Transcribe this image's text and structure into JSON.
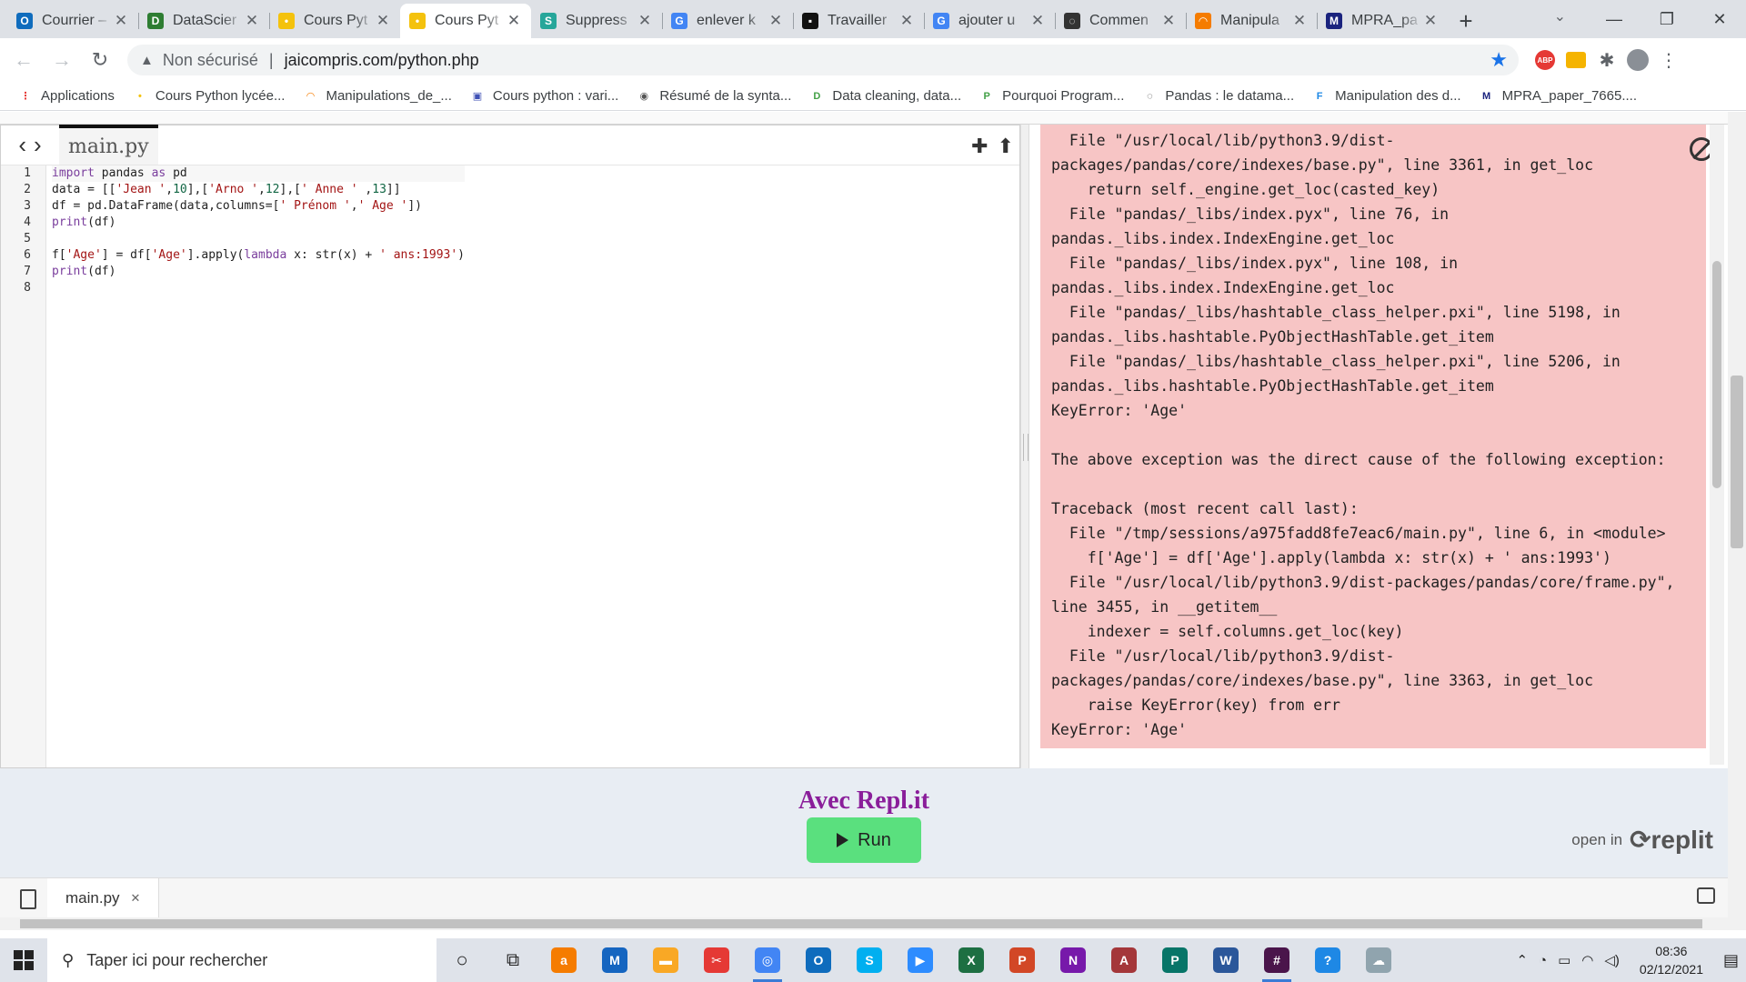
{
  "browser": {
    "tabs": [
      {
        "title": "Courrier –",
        "color": "#0f6cbd",
        "glyph": "O"
      },
      {
        "title": "DataScier",
        "color": "#2e7d32",
        "glyph": "D"
      },
      {
        "title": "Cours Pyt",
        "color": "#f4c20d",
        "glyph": "•"
      },
      {
        "title": "Cours Pyt",
        "color": "#f4c20d",
        "glyph": "•",
        "active": true
      },
      {
        "title": "Suppress",
        "color": "#26a69a",
        "glyph": "S"
      },
      {
        "title": "enlever k",
        "color": "#4285f4",
        "glyph": "G"
      },
      {
        "title": "Travailler",
        "color": "#111111",
        "glyph": "▪"
      },
      {
        "title": "ajouter u",
        "color": "#4285f4",
        "glyph": "G"
      },
      {
        "title": "Commen",
        "color": "#333333",
        "glyph": "◌"
      },
      {
        "title": "Manipula",
        "color": "#f57c00",
        "glyph": "◠"
      },
      {
        "title": "MPRA_pa",
        "color": "#1a237e",
        "glyph": "M"
      }
    ],
    "address": {
      "security": "Non sécurisé",
      "url": "jaicompris.com/python.php"
    },
    "bookmarks": [
      {
        "label": "Applications",
        "color": "#e53935",
        "glyph": "⋮"
      },
      {
        "label": "Cours Python lycée...",
        "color": "#f4c20d",
        "glyph": "•"
      },
      {
        "label": "Manipulations_de_...",
        "color": "#f57c00",
        "glyph": "◠"
      },
      {
        "label": "Cours python : vari...",
        "color": "#3f51b5",
        "glyph": "▣"
      },
      {
        "label": "Résumé de la synta...",
        "color": "#555555",
        "glyph": "◉"
      },
      {
        "label": "Data cleaning, data...",
        "color": "#43a047",
        "glyph": "D"
      },
      {
        "label": "Pourquoi Program...",
        "color": "#43a047",
        "glyph": "P"
      },
      {
        "label": "Pandas : le datama...",
        "color": "#333333",
        "glyph": "◌"
      },
      {
        "label": "Manipulation des d...",
        "color": "#1e88e5",
        "glyph": "F"
      },
      {
        "label": "MPRA_paper_7665....",
        "color": "#1a237e",
        "glyph": "M"
      }
    ]
  },
  "editor": {
    "file_tab": "main.py",
    "lines": [
      "1",
      "2",
      "3",
      "4",
      "5",
      "6",
      "7",
      "8"
    ]
  },
  "console": {
    "error_text": "  File \"/usr/local/lib/python3.9/dist-\npackages/pandas/core/indexes/base.py\", line 3361, in get_loc\n    return self._engine.get_loc(casted_key)\n  File \"pandas/_libs/index.pyx\", line 76, in\npandas._libs.index.IndexEngine.get_loc\n  File \"pandas/_libs/index.pyx\", line 108, in\npandas._libs.index.IndexEngine.get_loc\n  File \"pandas/_libs/hashtable_class_helper.pxi\", line 5198, in\npandas._libs.hashtable.PyObjectHashTable.get_item\n  File \"pandas/_libs/hashtable_class_helper.pxi\", line 5206, in\npandas._libs.hashtable.PyObjectHashTable.get_item\nKeyError: 'Age'\n\nThe above exception was the direct cause of the following exception:\n\nTraceback (most recent call last):\n  File \"/tmp/sessions/a975fadd8fe7eac6/main.py\", line 6, in <module>\n    f['Age'] = df['Age'].apply(lambda x: str(x) + ' ans:1993')\n  File \"/usr/local/lib/python3.9/dist-packages/pandas/core/frame.py\",\nline 3455, in __getitem__\n    indexer = self.columns.get_loc(key)\n  File \"/usr/local/lib/python3.9/dist-\npackages/pandas/core/indexes/base.py\", line 3363, in get_loc\n    raise KeyError(key) from err\nKeyError: 'Age'"
  },
  "runner": {
    "title": "Avec Repl.it",
    "run_label": "Run",
    "open_in": "open in",
    "brand": "replit"
  },
  "bottom_file_tab": "main.py",
  "taskbar": {
    "search_placeholder": "Taper ici pour rechercher",
    "time": "08:36",
    "date": "02/12/2021",
    "apps": [
      {
        "name": "avast",
        "color": "#f57c00",
        "glyph": "a"
      },
      {
        "name": "malwarebytes",
        "color": "#1565c0",
        "glyph": "M"
      },
      {
        "name": "explorer",
        "color": "#f9a825",
        "glyph": "▬"
      },
      {
        "name": "snip",
        "color": "#e53935",
        "glyph": "✂"
      },
      {
        "name": "chrome",
        "color": "#4285f4",
        "glyph": "◎",
        "running": true
      },
      {
        "name": "outlook",
        "color": "#0f6cbd",
        "glyph": "O"
      },
      {
        "name": "skype",
        "color": "#00aff0",
        "glyph": "S"
      },
      {
        "name": "zoom",
        "color": "#2d8cff",
        "glyph": "▶"
      },
      {
        "name": "excel",
        "color": "#1d6f42",
        "glyph": "X"
      },
      {
        "name": "powerpoint",
        "color": "#d24726",
        "glyph": "P"
      },
      {
        "name": "onenote",
        "color": "#7719aa",
        "glyph": "N"
      },
      {
        "name": "access",
        "color": "#a4373a",
        "glyph": "A"
      },
      {
        "name": "publisher",
        "color": "#077568",
        "glyph": "P"
      },
      {
        "name": "word",
        "color": "#2b579a",
        "glyph": "W"
      },
      {
        "name": "slack",
        "color": "#4a154b",
        "glyph": "#",
        "running": true
      },
      {
        "name": "help",
        "color": "#1e88e5",
        "glyph": "?"
      },
      {
        "name": "weather",
        "color": "#90a4ae",
        "glyph": "☁"
      }
    ]
  }
}
